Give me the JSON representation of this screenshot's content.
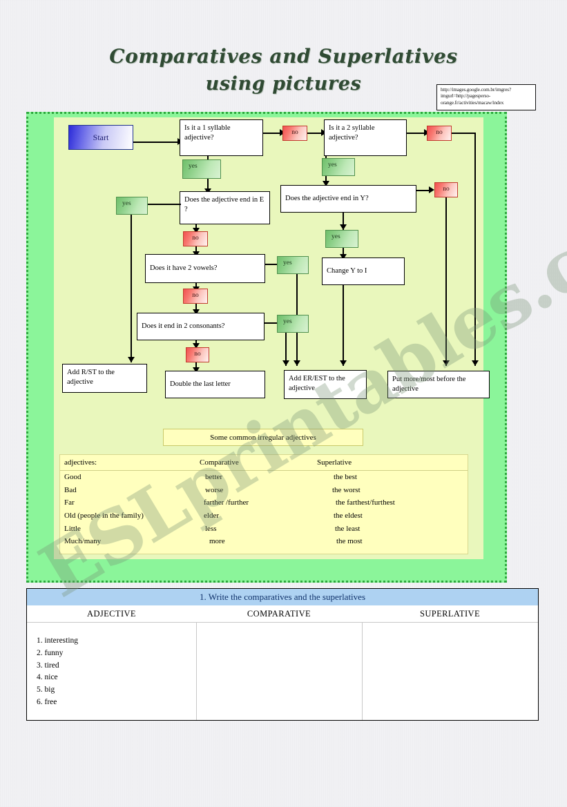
{
  "title": {
    "line1": "Comparatives and Superlatives",
    "line2": "using pictures"
  },
  "source_note": {
    "text": "http://images.google.com.br/imgres?imgurl=http://pagesperso-orange.fr/activities/macaw/index"
  },
  "watermark": {
    "text": "ESLprintables.com"
  },
  "flowchart": {
    "start_label": "Start",
    "q1": "Is it a 1 syllable adjective?",
    "q2": "Is it a 2 syllable adjective?",
    "q3": "Does the adjective end in E ?",
    "q4": "Does the adjective end in Y?",
    "q5": "Does it have 2 vowels?",
    "q6": "Does it end in 2 consonants?",
    "action_change_y": "Change Y to I",
    "action_rst": "Add R/ST to the adjective",
    "action_double": "Double the last letter",
    "action_erest": "Add ER/EST to the adjective",
    "action_more_most": "Put more/most before the adjective",
    "yes_label": "yes",
    "no_label": "no"
  },
  "irregular": {
    "banner": "Some common irregular adjectives",
    "headers": [
      "adjectives:",
      "Comparative",
      "Superlative"
    ],
    "rows": [
      [
        "Good",
        "better",
        "the best"
      ],
      [
        "Bad",
        "worse",
        "the worst"
      ],
      [
        "Far",
        "farther /further",
        "the farthest/furthest"
      ],
      [
        "Old (people in the family)",
        "elder",
        "the eldest"
      ],
      [
        "Little",
        "less",
        "the least"
      ],
      [
        "Much/many",
        "more",
        "the most"
      ]
    ]
  },
  "exercise": {
    "title": "1. Write the comparatives and the superlatives",
    "columns": [
      "ADJECTIVE",
      "COMPARATIVE",
      "SUPERLATIVE"
    ],
    "adjectives": [
      "1. interesting",
      "2. funny",
      "3. tired",
      "4. nice",
      "5. big",
      "6. free"
    ],
    "comparative_answers": [],
    "superlative_answers": []
  },
  "colors": {
    "panel_outer_green": "#8bf59a",
    "panel_inner_green": "#e9f7bc",
    "start_blue": "#2b2bd8",
    "yes_green": "#6fbf6a",
    "no_red": "#f05050",
    "banner_yellow": "#ffffbe",
    "exercise_blue": "#aed2f2",
    "title_green": "#2f4a33"
  }
}
